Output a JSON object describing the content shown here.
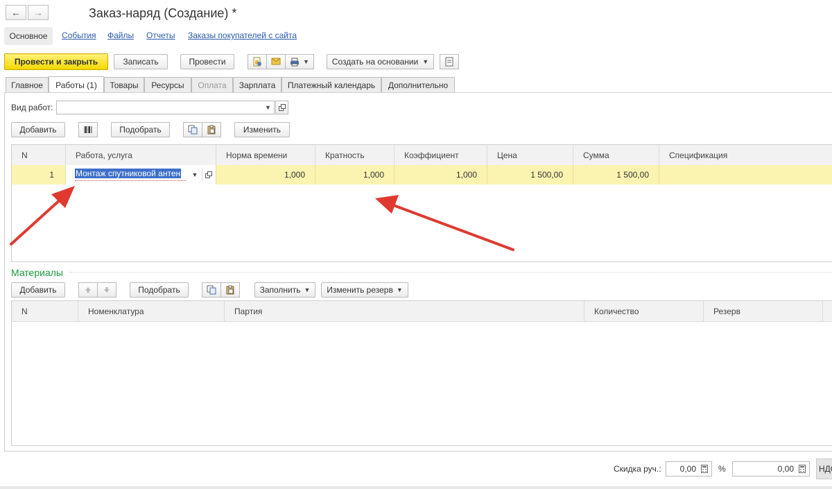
{
  "window": {
    "title": "Заказ-наряд (Создание) *"
  },
  "nav": {
    "back_glyph": "←",
    "forward_glyph": "→"
  },
  "sections": {
    "main": "Основное",
    "events": "События",
    "files": "Файлы",
    "reports": "Отчеты",
    "orders": "Заказы покупателей с сайта"
  },
  "toolbar": {
    "post_close": "Провести и закрыть",
    "save": "Записать",
    "post": "Провести",
    "create_based": "Создать на основании"
  },
  "tabs": [
    {
      "label": "Главное"
    },
    {
      "label": "Работы (1)"
    },
    {
      "label": "Товары"
    },
    {
      "label": "Ресурсы"
    },
    {
      "label": "Оплата"
    },
    {
      "label": "Зарплата"
    },
    {
      "label": "Платежный календарь"
    },
    {
      "label": "Дополнительно"
    }
  ],
  "work_type": {
    "label": "Вид работ:",
    "value": ""
  },
  "works_toolbar": {
    "add": "Добавить",
    "pick": "Подобрать",
    "change": "Изменить"
  },
  "works_table": {
    "columns": [
      "N",
      "Работа, услуга",
      "Норма времени",
      "Кратность",
      "Коэффициент",
      "Цена",
      "Сумма",
      "Спецификация"
    ],
    "rows": [
      {
        "n": "1",
        "work": "Монтаж спутниковой антен",
        "norm": "1,000",
        "multiplicity": "1,000",
        "coef": "1,000",
        "price": "1 500,00",
        "sum": "1 500,00",
        "spec": ""
      }
    ]
  },
  "materials": {
    "title": "Материалы",
    "add": "Добавить",
    "pick": "Подобрать",
    "fill": "Заполнить",
    "change_reserve": "Изменить резерв",
    "columns": [
      "N",
      "Номенклатура",
      "Партия",
      "Количество",
      "Резерв"
    ]
  },
  "footer": {
    "discount_label": "Скидка руч.:",
    "discount_value": "0,00",
    "percent": "%",
    "amount_value": "0,00",
    "vat": "НДС"
  },
  "colors": {
    "accent_yellow": "#f5d800",
    "row_highlight": "#fbf3b0",
    "link_blue": "#2a5aa8",
    "section_green": "#1a9a3c",
    "arrow_red": "#e03a30"
  }
}
